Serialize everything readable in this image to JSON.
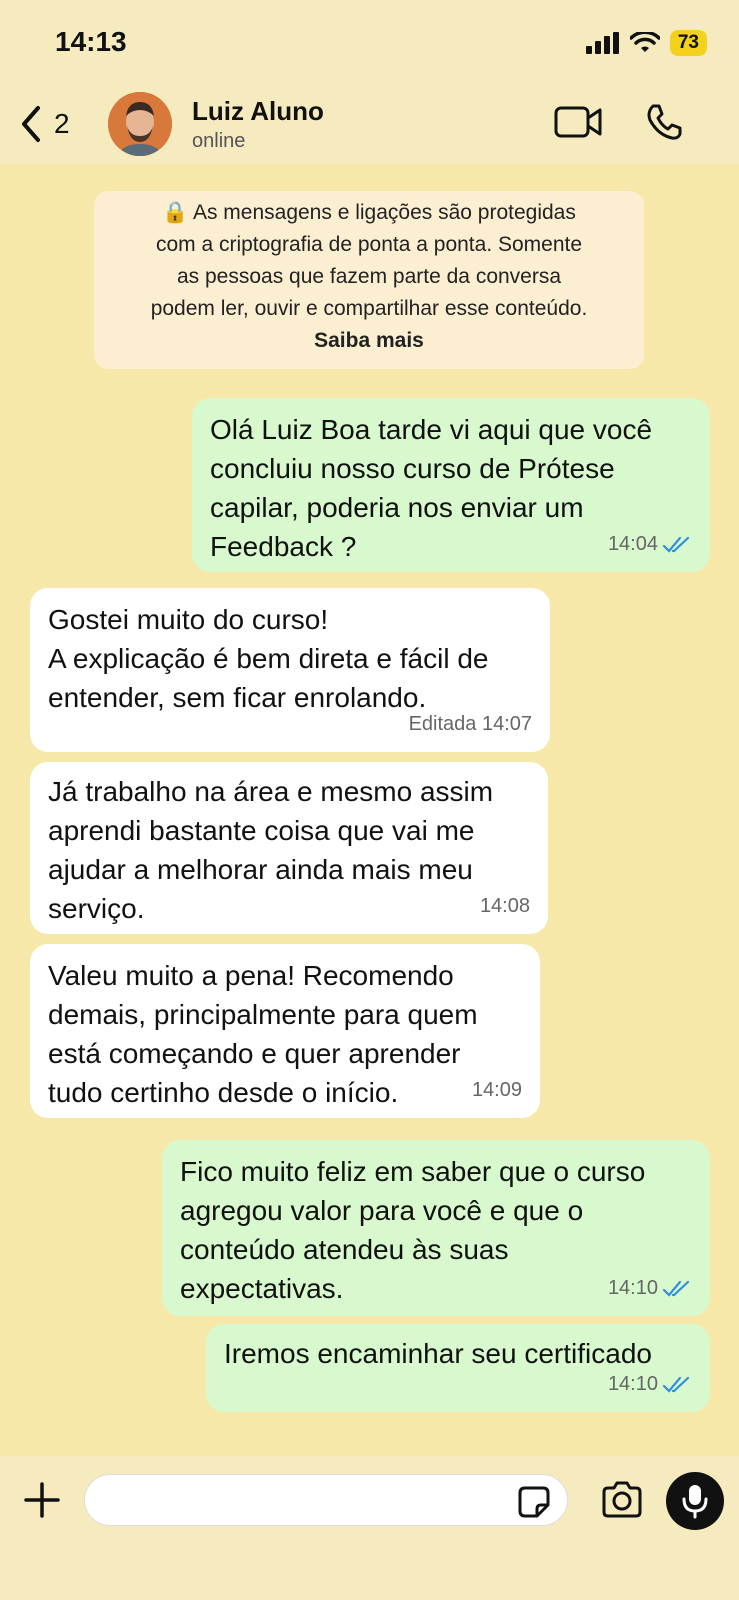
{
  "status_bar": {
    "time": "14:13",
    "battery": "73"
  },
  "header": {
    "back_count": "2",
    "contact_name": "Luiz Aluno",
    "contact_status": "online"
  },
  "encryption_notice": {
    "text": "🔒 As mensagens e ligações são protegidas\ncom a criptografia de ponta a ponta. Somente\nas pessoas que fazem parte da conversa\npodem ler, ouvir e compartilhar esse conteúdo.",
    "link": "Saiba mais"
  },
  "messages": [
    {
      "direction": "out",
      "text": "Olá Luiz Boa tarde vi aqui que você\nconcluiu nosso curso de Prótese\ncapilar, poderia nos enviar um\nFeedback ?",
      "time": "14:04",
      "read": true
    },
    {
      "direction": "in",
      "text": "Gostei muito do curso!\nA explicação é bem direta e fácil de\nentender, sem ficar enrolando.",
      "time": "Editada 14:07"
    },
    {
      "direction": "in",
      "text": "Já trabalho na área e mesmo assim\naprendi bastante coisa que vai me\najudar a melhorar ainda mais meu\nserviço.",
      "time": "14:08"
    },
    {
      "direction": "in",
      "text": "Valeu muito a pena! Recomendo\ndemais, principalmente para quem\nestá começando e quer aprender\ntudo certinho desde o início.",
      "time": "14:09"
    },
    {
      "direction": "out",
      "text": "Fico muito feliz em saber que o curso\nagregou valor para você e que o\nconteúdo atendeu às suas\nexpectativas.",
      "time": "14:10",
      "read": true
    },
    {
      "direction": "out",
      "text": "Iremos encaminhar seu certificado",
      "time": "14:10",
      "read": true
    }
  ],
  "colors": {
    "chat_bg": "#f7e8a9",
    "outgoing": "#d7f9cd",
    "incoming": "#ffffff",
    "read_ticks": "#2f8fdc"
  },
  "icons": [
    "back-chevron-icon",
    "video-call-icon",
    "phone-icon",
    "plus-icon",
    "sticker-icon",
    "camera-icon",
    "microphone-icon"
  ]
}
